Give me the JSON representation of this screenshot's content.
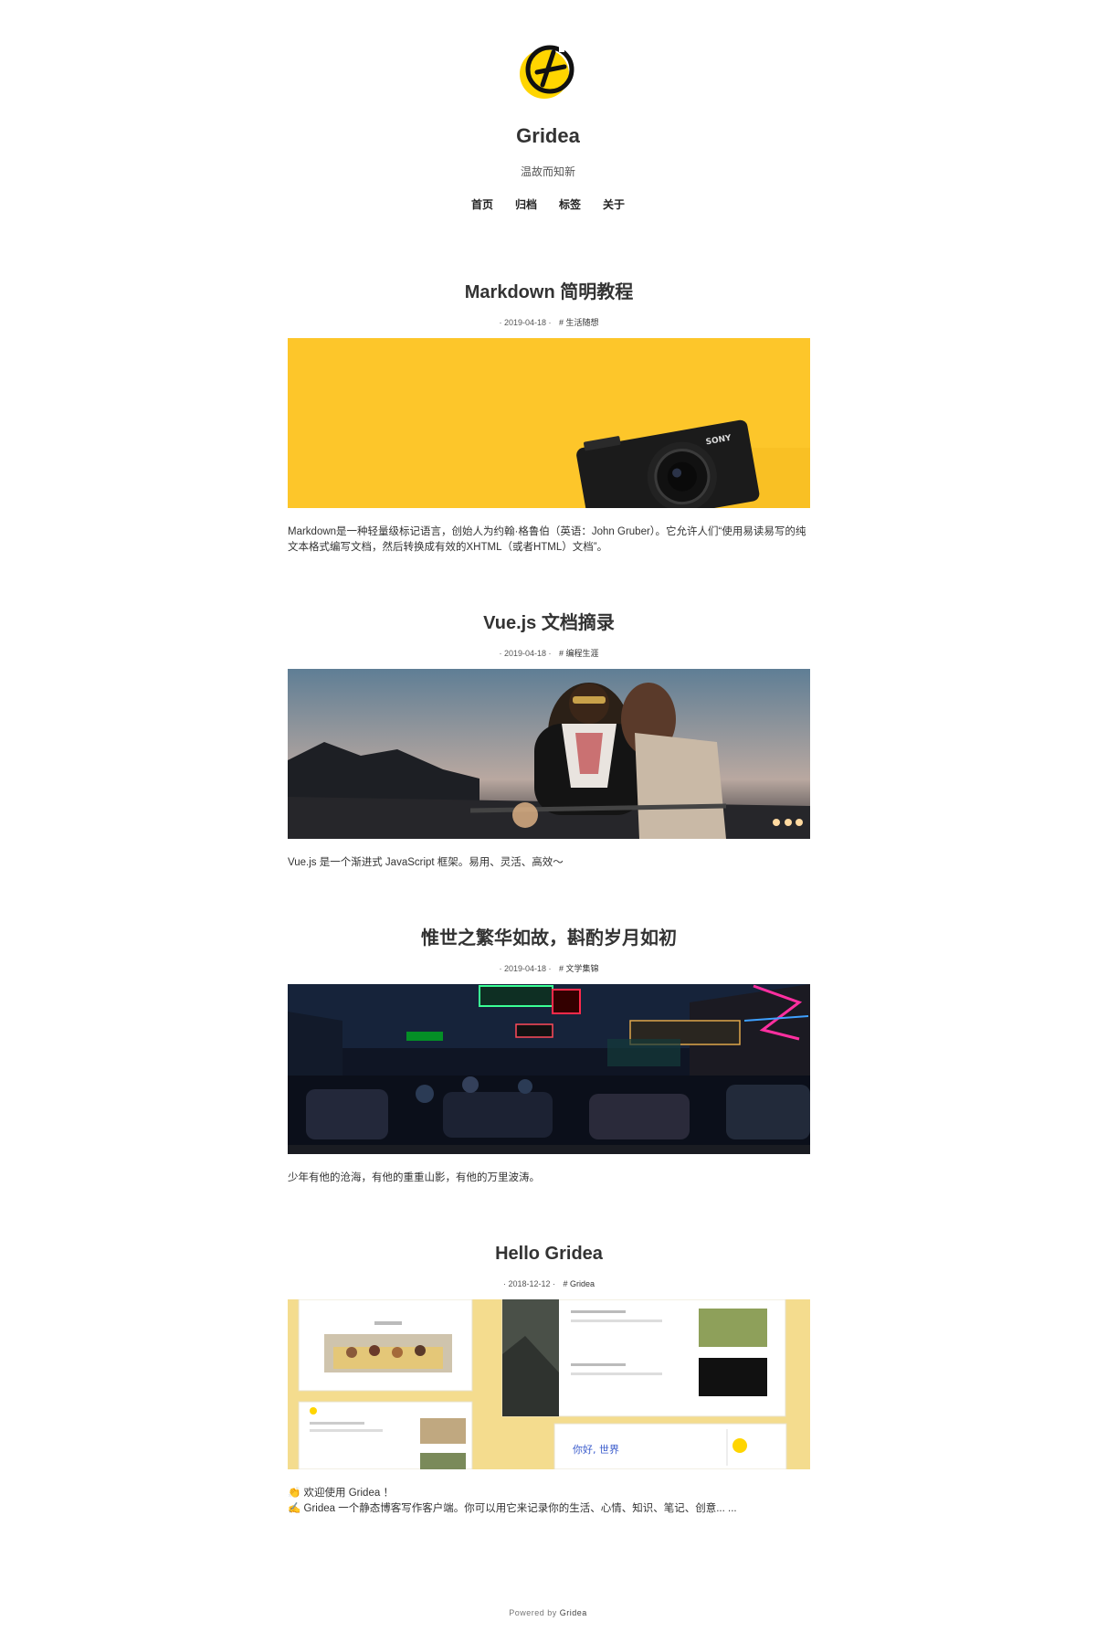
{
  "site": {
    "title": "Gridea",
    "description": "温故而知新",
    "logo_icon": "gridea-logo",
    "accent": "#FFD500"
  },
  "nav": [
    {
      "label": "首页"
    },
    {
      "label": "归档"
    },
    {
      "label": "标签"
    },
    {
      "label": "关于"
    }
  ],
  "posts": [
    {
      "title": "Markdown 简明教程",
      "date": "· 2019-04-18 ·",
      "tag": "# 生活随想",
      "image": "yellow-background-sony-camera",
      "abstract": "Markdown是一种轻量级标记语言，创始人为约翰·格鲁伯（英语：John Gruber）。它允许人们“使用易读易写的纯文本格式编写文档，然后转换成有效的XHTML（或者HTML）文档”。"
    },
    {
      "title": "Vue.js 文档摘录",
      "date": "· 2019-04-18 ·",
      "tag": "# 编程生涯",
      "image": "couple-on-motorcycle-dusk",
      "abstract": "Vue.js 是一个渐进式 JavaScript 框架。易用、灵活、高效～"
    },
    {
      "title": "惟世之繁华如故，斟酌岁月如初",
      "date": "· 2019-04-18 ·",
      "tag": "# 文学集锦",
      "image": "neon-street-night",
      "abstract": "少年有他的沧海，有他的重重山影，有他的万里波涛。"
    },
    {
      "title": "Hello Gridea",
      "date": "· 2018-12-12 ·",
      "tag": "# Gridea",
      "image": "gridea-theme-screenshots",
      "abstract_line1_prefix": "👏",
      "abstract_line1": "欢迎使用 Gridea ！",
      "abstract_line2_prefix": "✍️",
      "abstract_line2": "Gridea 一个静态博客写作客户端。你可以用它来记录你的生活、心情、知识、笔记、创意... ..."
    }
  ],
  "footer": {
    "prefix": "Powered by",
    "brand": "Gridea"
  }
}
